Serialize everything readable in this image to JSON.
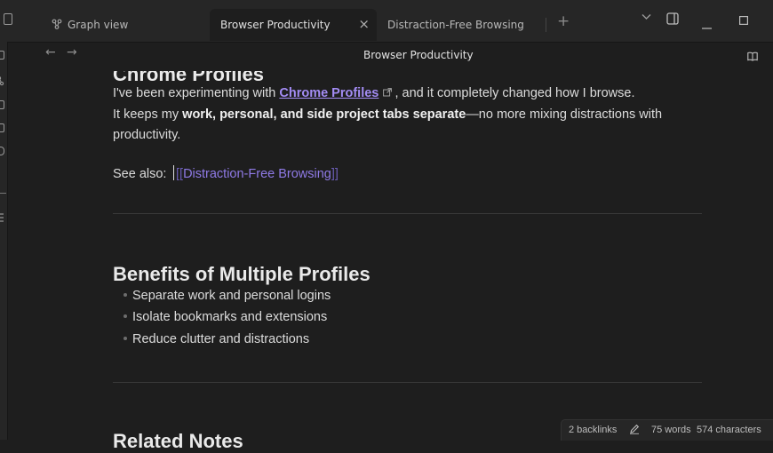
{
  "tabs": [
    {
      "label": "Graph view",
      "icon": "graph-icon"
    },
    {
      "label": "Browser Productivity",
      "icon": null,
      "active": true
    },
    {
      "label": "Distraction-Free Browsing",
      "icon": null
    }
  ],
  "tab_close_glyph": "×",
  "new_tab_glyph": "+",
  "header": {
    "title": "Browser Productivity",
    "back": "←",
    "forward": "→"
  },
  "note": {
    "heading_top": "Chrome Profiles",
    "p1_text_a": "I've been experimenting with ",
    "p1_link": "Chrome Profiles",
    "p1_text_b": ", and it completely changed how I browse.",
    "p2_text_a": "It keeps my ",
    "p2_bold": "work, personal, and side project tabs separate",
    "p2_text_b": "—no more mixing distractions with productivity.",
    "see_also_label": "See also: ",
    "see_also_link": "Distraction-Free Browsing",
    "heading_benefits": "Benefits of Multiple Profiles",
    "bullets": [
      "Separate work and personal logins",
      "Isolate bookmarks and extensions",
      "Reduce clutter and distractions"
    ],
    "heading_related": "Related Notes"
  },
  "status": {
    "backlinks": "2 backlinks",
    "words": "75 words",
    "characters": "574 characters"
  },
  "colors": {
    "accent": "#a38cf4",
    "background": "#1e1e1e",
    "chrome": "#262626"
  }
}
